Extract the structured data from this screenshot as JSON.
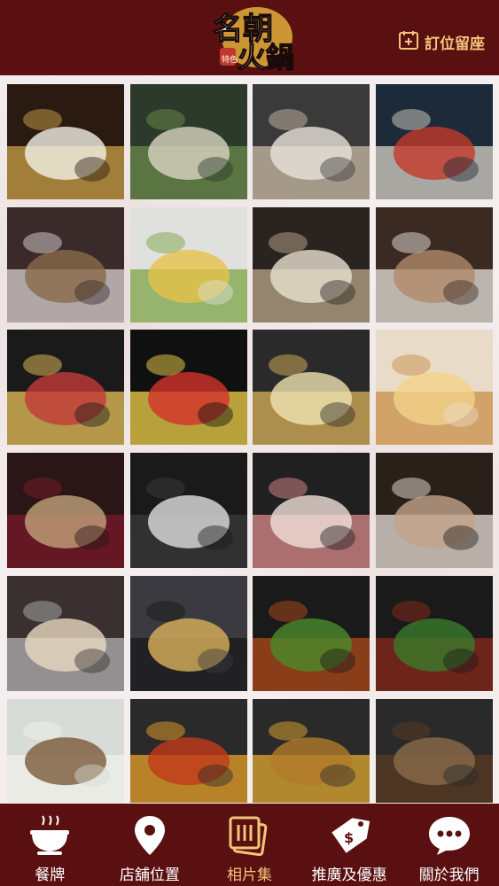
{
  "header": {
    "logo_text": "名朝火鍋",
    "logo_sub": "特色",
    "book_label": "訂位留座",
    "book_icon": "calendar-plus-icon"
  },
  "colors": {
    "brand": "#5a1010",
    "accent": "#f2c57a",
    "text": "#ffffff"
  },
  "gallery": {
    "photos": [
      "restaurant-logo-wall",
      "dining-hall",
      "meat-display-counter",
      "drink-refrigerators",
      "seafood-counter",
      "vegetable-shelves",
      "buffet-bar",
      "sashimi-ice-counter",
      "dessert-table",
      "pudding-cups",
      "layered-cake",
      "creme-brulee-cups",
      "cranberry-cake",
      "sauce-station",
      "sliced-meat-trays",
      "food-station",
      "cotton-candy-machine",
      "menu-cards",
      "spicy-chicken-pot",
      "stir-fry-pot",
      "chicken-soup-pot",
      "tomato-soup-pot",
      "golden-broth-pot",
      "herbal-soup-pot"
    ]
  },
  "tabs": [
    {
      "label": "餐牌",
      "icon": "food-tray-icon",
      "active": false
    },
    {
      "label": "店舖位置",
      "icon": "map-pin-icon",
      "active": false
    },
    {
      "label": "相片集",
      "icon": "photo-album-icon",
      "active": true
    },
    {
      "label": "推廣及優惠",
      "icon": "price-tag-icon",
      "active": false
    },
    {
      "label": "關於我們",
      "icon": "chat-bubble-icon",
      "active": false
    }
  ]
}
